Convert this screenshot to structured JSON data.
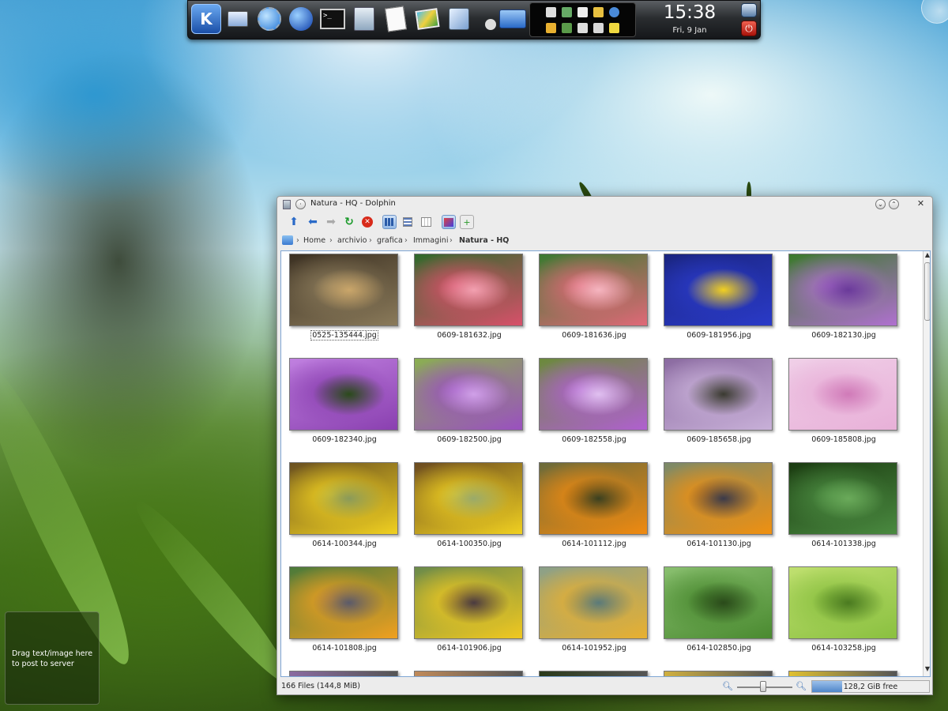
{
  "panel": {
    "launchers": [
      {
        "name": "kde-menu-icon"
      },
      {
        "name": "system-settings-icon"
      },
      {
        "name": "network-settings-icon"
      },
      {
        "name": "web-browser-icon"
      },
      {
        "name": "terminal-icon"
      },
      {
        "name": "file-cabinet-icon"
      },
      {
        "name": "text-editor-icon"
      },
      {
        "name": "image-viewer-icon"
      },
      {
        "name": "cube-icon"
      },
      {
        "name": "paint-tool-icon"
      },
      {
        "name": "home-folder-icon"
      }
    ],
    "tray_icons": [
      "volume-icon",
      "battery-icon",
      "clipboard-icon",
      "folder-icon",
      "network-icon",
      "key-icon",
      "shield-icon",
      "notes-icon",
      "calendar-icon",
      "sticky-note-icon"
    ],
    "clock": {
      "time": "15:38",
      "date": "Fri, 9 Jan"
    }
  },
  "paste_widget": {
    "text": "Drag text/image here to post to server"
  },
  "window": {
    "title": "Natura - HQ - Dolphin",
    "breadcrumbs": [
      "Home",
      "archivio",
      "grafica",
      "Immagini",
      "Natura - HQ"
    ],
    "files": [
      {
        "name": "0525-135444.jpg",
        "colors": [
          "#8a7a5a",
          "#caa66a",
          "#3b3022"
        ]
      },
      {
        "name": "0609-181632.jpg",
        "colors": [
          "#d8506a",
          "#f2a0b0",
          "#2e6a2a"
        ]
      },
      {
        "name": "0609-181636.jpg",
        "colors": [
          "#e06878",
          "#f5b5c0",
          "#3a7a30"
        ]
      },
      {
        "name": "0609-181956.jpg",
        "colors": [
          "#2a3ac8",
          "#f2d020",
          "#1a2580"
        ]
      },
      {
        "name": "0609-182130.jpg",
        "colors": [
          "#b070d0",
          "#6a3a9a",
          "#3a7a2a"
        ]
      },
      {
        "name": "0609-182340.jpg",
        "colors": [
          "#8a40b0",
          "#2a4a1a",
          "#c080e0"
        ]
      },
      {
        "name": "0609-182500.jpg",
        "colors": [
          "#9a50c0",
          "#d0a0e8",
          "#8ab050"
        ]
      },
      {
        "name": "0609-182558.jpg",
        "colors": [
          "#b060d0",
          "#e0c0f0",
          "#6a8a3a"
        ]
      },
      {
        "name": "0609-185658.jpg",
        "colors": [
          "#c8b0d8",
          "#3a3a30",
          "#8a6aa0"
        ]
      },
      {
        "name": "0609-185808.jpg",
        "colors": [
          "#e8b0d8",
          "#d07ab8",
          "#f0d0e8"
        ]
      },
      {
        "name": "0614-100344.jpg",
        "colors": [
          "#f0d020",
          "#8a9a5a",
          "#6a5020"
        ]
      },
      {
        "name": "0614-100350.jpg",
        "colors": [
          "#f0d020",
          "#9aaa6a",
          "#6a4a20"
        ]
      },
      {
        "name": "0614-101112.jpg",
        "colors": [
          "#f08a10",
          "#3a4020",
          "#6a6a3a"
        ]
      },
      {
        "name": "0614-101130.jpg",
        "colors": [
          "#f09010",
          "#3a3a4a",
          "#7a8a6a"
        ]
      },
      {
        "name": "0614-101338.jpg",
        "colors": [
          "#4a8a40",
          "#6aaa5a",
          "#1a3a10"
        ]
      },
      {
        "name": "0614-101808.jpg",
        "colors": [
          "#f0a020",
          "#5a5a6a",
          "#4a7a3a"
        ]
      },
      {
        "name": "0614-101906.jpg",
        "colors": [
          "#f0c820",
          "#4a3a40",
          "#6a8a4a"
        ]
      },
      {
        "name": "0614-101952.jpg",
        "colors": [
          "#e8b030",
          "#5a7a7a",
          "#8aa08a"
        ]
      },
      {
        "name": "0614-102850.jpg",
        "colors": [
          "#4a8a30",
          "#2a4a1a",
          "#8ac070"
        ]
      },
      {
        "name": "0614-103258.jpg",
        "colors": [
          "#8ac040",
          "#4a7a20",
          "#c0e070"
        ]
      }
    ],
    "partial_row_colors": [
      "#8a6aa0",
      "#c08a5a",
      "#2a3a1a",
      "#d0b040",
      "#e0c030"
    ],
    "status": {
      "summary": "166 Files (144,8 MiB)",
      "disk_free": "128,2 GiB free",
      "disk_used_fraction": 0.26
    }
  }
}
